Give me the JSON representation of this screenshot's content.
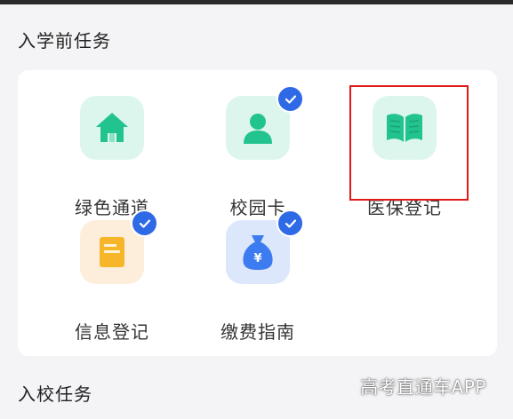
{
  "sections": {
    "pre_enrollment_title": "入学前任务",
    "enrollment_title": "入校任务"
  },
  "tasks": [
    {
      "label": "绿色通道",
      "icon": "home-icon",
      "completed": false,
      "highlighted": false
    },
    {
      "label": "校园卡",
      "icon": "person-icon",
      "completed": true,
      "highlighted": false
    },
    {
      "label": "医保登记",
      "icon": "book-icon",
      "completed": false,
      "highlighted": true
    },
    {
      "label": "信息登记",
      "icon": "document-icon",
      "completed": true,
      "highlighted": false
    },
    {
      "label": "缴费指南",
      "icon": "money-bag-icon",
      "completed": true,
      "highlighted": false
    }
  ],
  "watermark": "高考直通车APP",
  "colors": {
    "accent_green": "#22c38e",
    "check_blue": "#2f6ae6",
    "highlight_red": "#e01919",
    "doc_orange": "#f7b52a",
    "bag_blue": "#3d7cf0"
  }
}
